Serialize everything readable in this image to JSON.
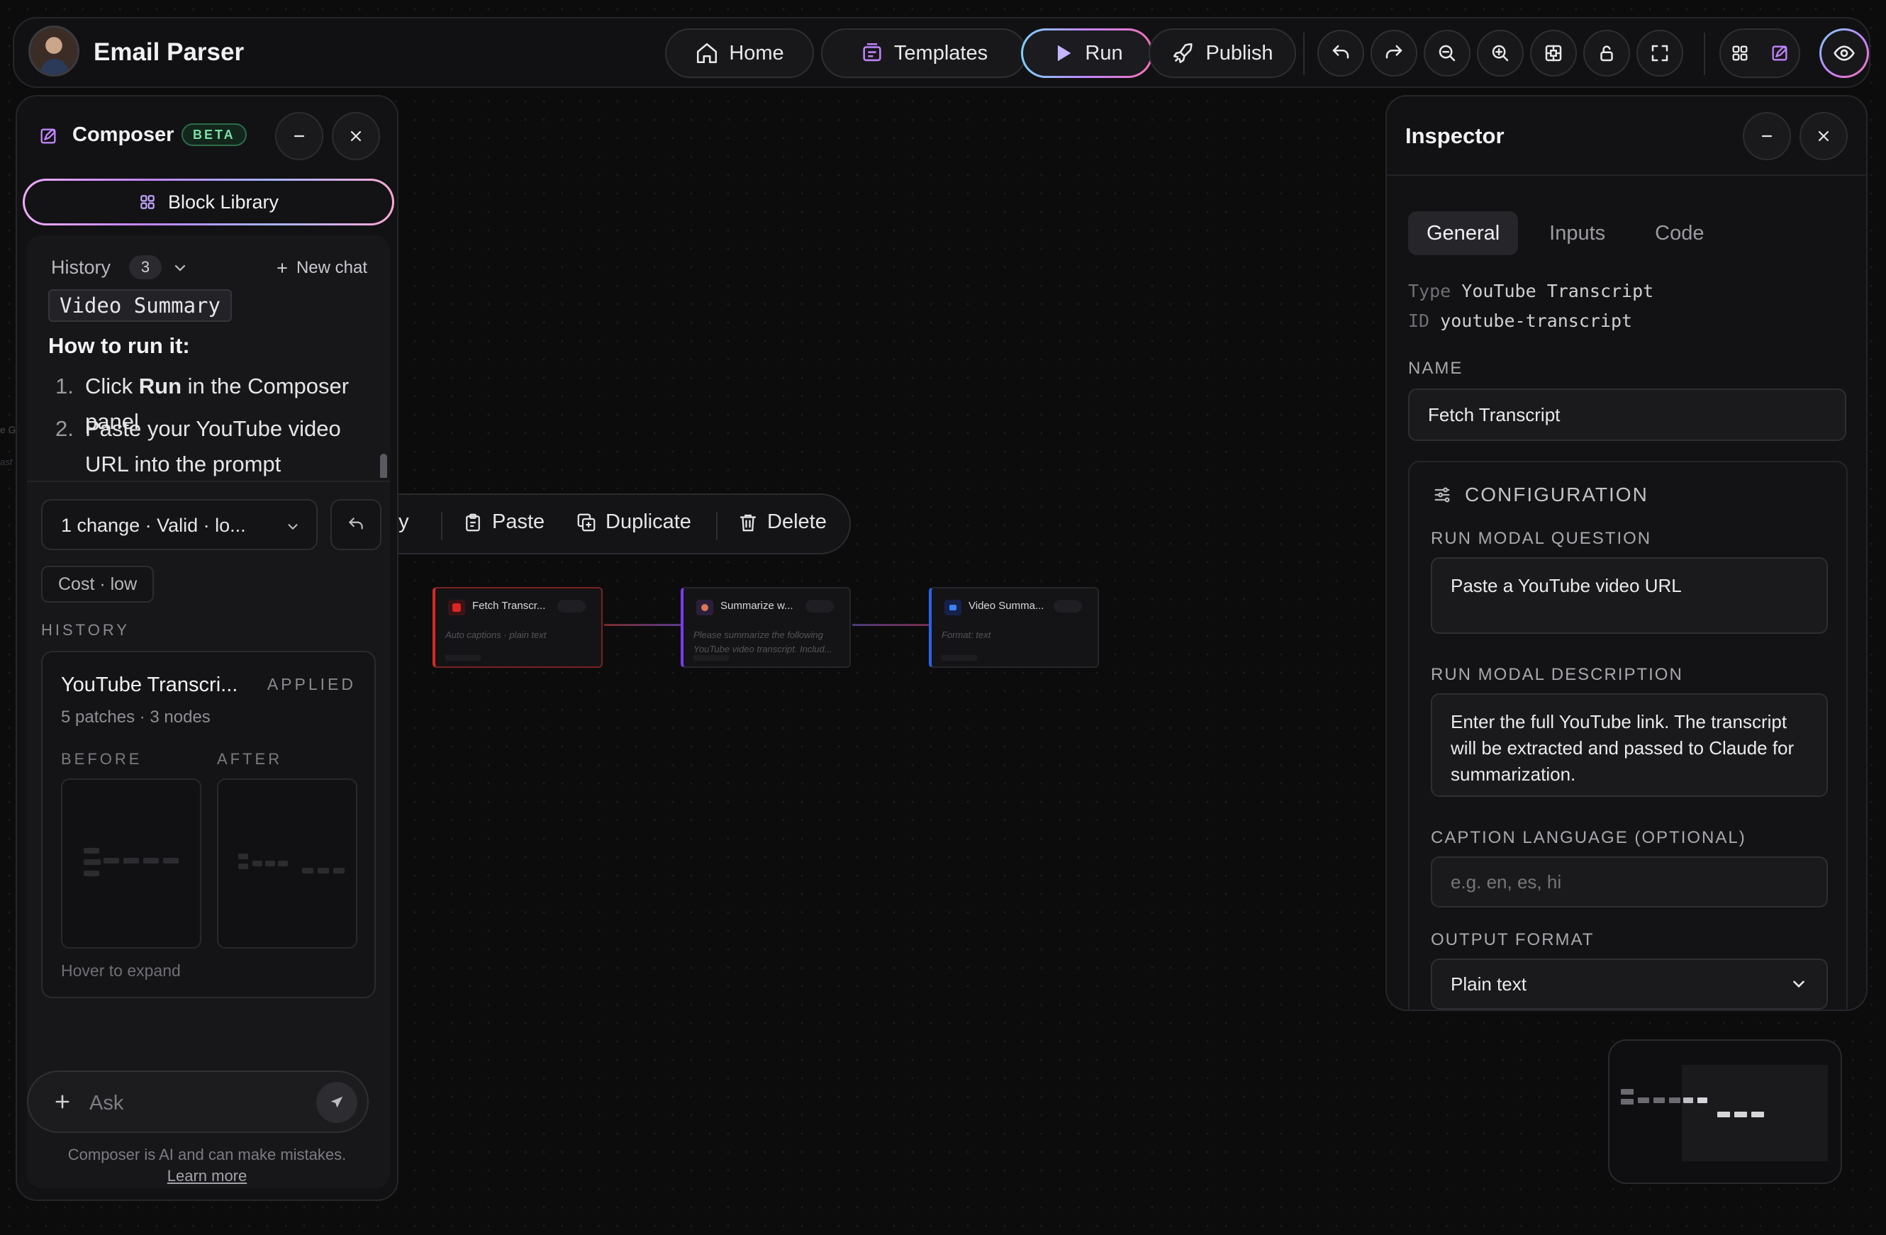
{
  "app": {
    "title": "Email Parser"
  },
  "topbar": {
    "home_label": "Home",
    "templates_label": "Templates",
    "run_label": "Run",
    "publish_label": "Publish",
    "icons": [
      "undo-icon",
      "redo-icon",
      "zoom-out-icon",
      "zoom-in-icon",
      "fit-view-icon",
      "lock-icon",
      "fullscreen-icon",
      "grid-icon",
      "composer-icon",
      "eye-icon"
    ]
  },
  "composer": {
    "title": "Composer",
    "badge": "BETA",
    "block_library_label": "Block Library",
    "history_label": "History",
    "history_count": "3",
    "new_chat_label": "New chat",
    "message": {
      "code_chip": "Video Summary",
      "heading": "How to run it:",
      "steps": [
        {
          "num": "1.",
          "before": "Click ",
          "bold": "Run",
          "after": " in the Composer panel"
        },
        {
          "num": "2.",
          "text": "Paste your YouTube video URL into the prompt"
        }
      ]
    },
    "change_summary": "1 change · Valid · lo...",
    "cost": "Cost · low",
    "history_heading": "HISTORY",
    "history_card": {
      "title": "YouTube Transcri...",
      "status": "APPLIED",
      "subtitle": "5 patches · 3 nodes",
      "before_label": "BEFORE",
      "after_label": "AFTER",
      "hint": "Hover to expand"
    },
    "input_placeholder": "Ask",
    "disclaimer": "Composer is AI and can make mistakes.",
    "learn_more": "Learn more"
  },
  "canvas": {
    "toolbar": {
      "copy_label": "py",
      "paste_label": "Paste",
      "duplicate_label": "Duplicate",
      "delete_label": "Delete"
    },
    "edge_fragment_1": "e Ge",
    "edge_fragment_2": "ast",
    "nodes": [
      {
        "title": "Fetch Transcr...",
        "subtitle": "Auto captions · plain text",
        "accent": "#dc2626"
      },
      {
        "title": "Summarize w...",
        "subtitle": "Please summarize the following YouTube video transcript. Includ...",
        "accent": "#7c3aed"
      },
      {
        "title": "Video Summa...",
        "subtitle": "Format: text",
        "accent": "#2563eb"
      }
    ]
  },
  "inspector": {
    "title": "Inspector",
    "tabs": [
      "General",
      "Inputs",
      "Code"
    ],
    "active_tab": "General",
    "type_key": "Type",
    "type_value": "YouTube Transcript",
    "id_key": "ID",
    "id_value": "youtube-transcript",
    "name_label": "NAME",
    "name_value": "Fetch Transcript",
    "config_heading": "CONFIGURATION",
    "question_label": "RUN MODAL QUESTION",
    "question_value": "Paste a YouTube video URL",
    "description_label": "RUN MODAL DESCRIPTION",
    "description_value": "Enter the full YouTube link. The transcript will be extracted and passed to Claude for summarization.",
    "language_label": "CAPTION LANGUAGE (OPTIONAL)",
    "language_placeholder": "e.g. en, es, hi",
    "format_label": "OUTPUT FORMAT",
    "format_value": "Plain text"
  },
  "colors": {
    "background": "#0c0c0d",
    "panel": "#121214",
    "accent_run_gradient": [
      "#7dd3fc",
      "#c084fc",
      "#f472b6"
    ],
    "beta_green": "#7be0a8"
  }
}
